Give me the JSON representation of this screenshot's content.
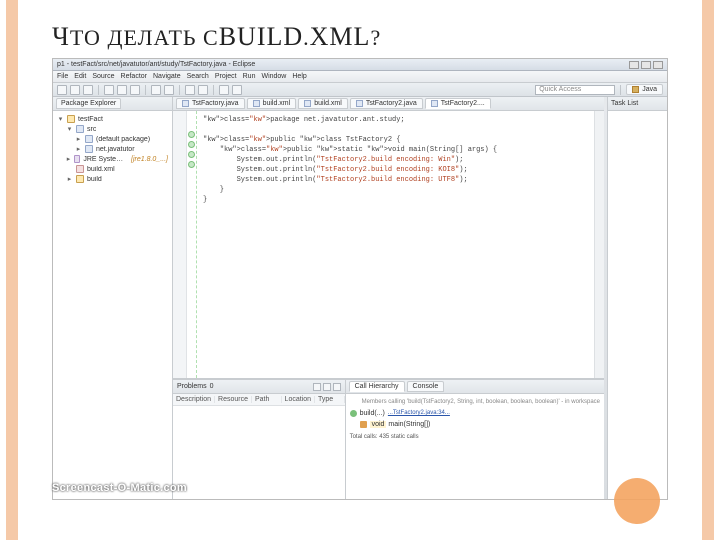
{
  "slide": {
    "title_html": "Ч<span>ТО ДЕЛАТЬ С</span>BUILD.XML?",
    "title_parts": {
      "p1": "Ч",
      "p2": "ТО ДЕЛАТЬ С",
      "p3": "BUILD",
      "p4": ".",
      "p5": "XML",
      "p6": "?"
    },
    "watermark": "Screencast-O-Matic.com"
  },
  "window": {
    "title": "p1 - testFact/src/net/javatutor/ant/study/TstFactory.java - Eclipse"
  },
  "menu": [
    "File",
    "Edit",
    "Source",
    "Refactor",
    "Navigate",
    "Search",
    "Project",
    "Run",
    "Window",
    "Help"
  ],
  "search_placeholder": "Quick Access",
  "perspectives": [
    {
      "label": "Java"
    }
  ],
  "sidebar": {
    "tabs": [
      {
        "label": "Package Explorer"
      }
    ],
    "tree": [
      {
        "indent": 0,
        "toggle": "▾",
        "icon": "proj",
        "label": "testFact"
      },
      {
        "indent": 1,
        "toggle": "▾",
        "icon": "src",
        "label": "src"
      },
      {
        "indent": 2,
        "toggle": "▸",
        "icon": "pkg",
        "label": "(default package)"
      },
      {
        "indent": 2,
        "toggle": "▸",
        "icon": "pkg",
        "label": "net.javatutor"
      },
      {
        "indent": 1,
        "toggle": "▸",
        "icon": "jar",
        "label": "JRE System Library",
        "suffix": "[jre1.8.0_...]"
      },
      {
        "indent": 1,
        "toggle": " ",
        "icon": "xml",
        "label": "build.xml"
      },
      {
        "indent": 1,
        "toggle": "▸",
        "icon": "fld",
        "label": "build"
      }
    ]
  },
  "editor": {
    "tabs": [
      {
        "label": "TstFactory.java",
        "active": false
      },
      {
        "label": "build.xml",
        "active": false
      },
      {
        "label": "build.xml",
        "active": false
      },
      {
        "label": "TstFactory2.java",
        "active": false
      },
      {
        "label": "TstFactory2....",
        "active": true
      }
    ],
    "code_lines": [
      "package net.javatutor.ant.study;",
      "",
      "public class TstFactory2 {",
      "    public static void main(String[] args) {",
      "        System.out.println(\"TstFactory2.build encoding: Win\");",
      "        System.out.println(\"TstFactory2.build encoding: KOI8\");",
      "        System.out.println(\"TstFactory2.build encoding: UTF8\");",
      "    }",
      "}"
    ]
  },
  "rightpanel": {
    "tab": "Task List"
  },
  "problems": {
    "title": "Problems",
    "count_badge": "0",
    "columns": [
      "Description",
      "Resource",
      "Path",
      "Location",
      "Type"
    ]
  },
  "outline": {
    "tabs": [
      {
        "label": "Call Hierarchy",
        "active": true
      },
      {
        "label": "Console",
        "active": false
      }
    ],
    "header": "Members calling 'build(TstFactory2, String, int, boolean, boolean, boolean)' - in workspace",
    "items": [
      {
        "icon": "m",
        "label": "build(...)",
        "more": "...TstFactory2.java:34..."
      },
      {
        "icon": "c",
        "label": "main",
        "ret": "void",
        "sig": "main(String[])"
      }
    ],
    "totals": "Total calls: 435  static calls"
  }
}
